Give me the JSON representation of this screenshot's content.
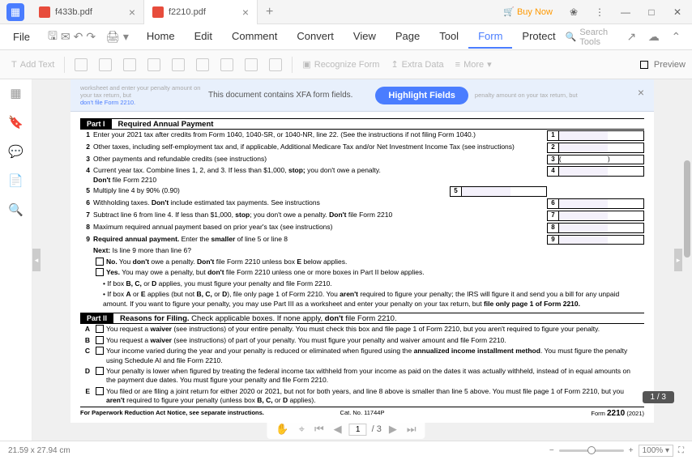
{
  "tabs": [
    {
      "name": "f433b.pdf",
      "active": false
    },
    {
      "name": "f2210.pdf",
      "active": true
    }
  ],
  "buy_now": "Buy Now",
  "file_menu": "File",
  "menu_tabs": {
    "home": "Home",
    "edit": "Edit",
    "comment": "Comment",
    "convert": "Convert",
    "view": "View",
    "page": "Page",
    "tool": "Tool",
    "form": "Form",
    "protect": "Protect"
  },
  "search_tools": "Search Tools",
  "toolbar": {
    "add_text": "Add Text",
    "recognize": "Recognize Form",
    "extra": "Extra Data",
    "more": "More",
    "preview": "Preview"
  },
  "xfa": {
    "left_hint_gray": "worksheet and  enter your penalty amount on your tax return, but",
    "left_hint_blue": "don't file Form 2210.",
    "msg": "This document contains XFA form fields.",
    "right_hint": "penalty amount on your tax return, but",
    "highlight": "Highlight Fields"
  },
  "form": {
    "part1": {
      "label": "Part I",
      "title": "Required Annual Payment"
    },
    "lines": [
      {
        "n": "1",
        "t": "Enter your 2021 tax after credits from Form 1040, 1040-SR, or 1040-NR, line 22. (See the instructions if not filing Form 1040.)",
        "box": "1"
      },
      {
        "n": "2",
        "t_a": "Other taxes, including self-employment tax and, if applicable, Additional Medicare Tax and/or Net Investment Income Tax (see instructions)",
        "box": "2"
      },
      {
        "n": "3",
        "t": "Other payments and refundable credits (see instructions)",
        "box": "3",
        "paren": ")"
      },
      {
        "n": "4",
        "t_a": "Current year tax. Combine lines 1, 2, and 3. If less than $1,000, ",
        "t_b": "stop;",
        "t_c": " you don't owe a penalty.",
        "t_d": "Don't",
        "t_e": " file Form 2210",
        "box": "4"
      },
      {
        "n": "5",
        "t": "Multiply line 4 by 90% (0.90)",
        "box": "5"
      },
      {
        "n": "6",
        "t_a": "Withholding taxes. ",
        "t_b": "Don't",
        "t_c": " include estimated tax payments. See instructions",
        "box": "6"
      },
      {
        "n": "7",
        "t_a": "Subtract line 6 from line 4. If less than $1,000, ",
        "t_b": "stop",
        "t_c": "; you don't owe a penalty. ",
        "t_d": "Don't",
        "t_e": " file Form 2210",
        "box": "7"
      },
      {
        "n": "8",
        "t": "Maximum required annual payment based on prior year's tax (see instructions)",
        "box": "8"
      },
      {
        "n": "9",
        "t_a": "Required annual payment.",
        "t_b": "  Enter the ",
        "t_c": "smaller",
        "t_d": " of line 5 or line 8",
        "box": "9"
      }
    ],
    "next": {
      "lbl": "Next:",
      "txt": " Is line 9 more than line 6?"
    },
    "no": {
      "lbl": "No.",
      "a": " You ",
      "b": "don't",
      "c": " owe a penalty. ",
      "d": "Don't",
      "e": " file Form 2210 unless box ",
      "f": "E",
      "g": " below applies."
    },
    "yes": {
      "lbl": "Yes.",
      "a": " You may owe a penalty, but ",
      "b": "don't",
      "c": " file Form 2210 unless one or more boxes in Part II below applies."
    },
    "bullet1": {
      "a": "• If box ",
      "b": "B, C,",
      "c": " or ",
      "d": "D",
      "e": " applies, you must figure your penalty and file Form 2210."
    },
    "bullet2": {
      "a": "• If box ",
      "b": "A",
      "c": " or ",
      "d": "E",
      "e": " applies (but not ",
      "f": "B, C,",
      "g": " or ",
      "h": "D",
      "i": "), file only page 1 of Form 2210. You ",
      "j": "aren't",
      "k": " required to figure your penalty; the IRS will figure it and send you a bill for any unpaid amount. If you want to figure your penalty, you may use Part III as a worksheet and enter your penalty on your tax return, but ",
      "l": "file only page 1 of Form 2210."
    },
    "part2": {
      "label": "Part II",
      "title": "Reasons for Filing.",
      "sub": " Check applicable boxes. If none apply, ",
      "sub_b": "don't",
      "sub_c": " file Form 2210."
    },
    "reasons": [
      {
        "n": "A",
        "t_a": "You request a ",
        "t_b": "waiver",
        "t_c": " (see instructions) of your entire penalty. You must check this box and file page 1 of Form 2210, but you aren't required to figure your penalty."
      },
      {
        "n": "B",
        "t_a": "You request a ",
        "t_b": "waiver",
        "t_c": " (see instructions) of part of your penalty. You must figure your penalty and waiver amount and file Form 2210."
      },
      {
        "n": "C",
        "t_a": "Your income varied during the year and your penalty is reduced or eliminated when figured using the ",
        "t_b": "annualized income installment method",
        "t_c": ". You must figure the penalty using Schedule AI and file Form 2210."
      },
      {
        "n": "D",
        "t_a": "Your penalty is lower when figured by treating the federal income tax withheld from your income as paid on the dates it was actually withheld, instead of in equal amounts on the payment due dates. You must figure your penalty and file Form 2210."
      },
      {
        "n": "E",
        "t_a": "You filed or are filing a joint return for either 2020 or 2021, but not for both years, and line 8 above is smaller than line 5 above. You must file page 1 of Form 2210, but you ",
        "t_b": "aren't",
        "t_c": " required to figure your penalty (unless box ",
        "t_d": "B, C,",
        "t_e": " or ",
        "t_f": "D",
        "t_g": " applies)."
      }
    ],
    "footer": {
      "l": "For Paperwork Reduction Act Notice, see separate instructions.",
      "c": "Cat. No. 11744P",
      "r_a": "Form ",
      "r_b": "2210",
      "r_c": " (2021)"
    }
  },
  "page_badge": "1 / 3",
  "status_size": "21.59 x 27.94 cm",
  "pager": {
    "current": "1",
    "total": "/ 3"
  },
  "zoom_val": "100%"
}
